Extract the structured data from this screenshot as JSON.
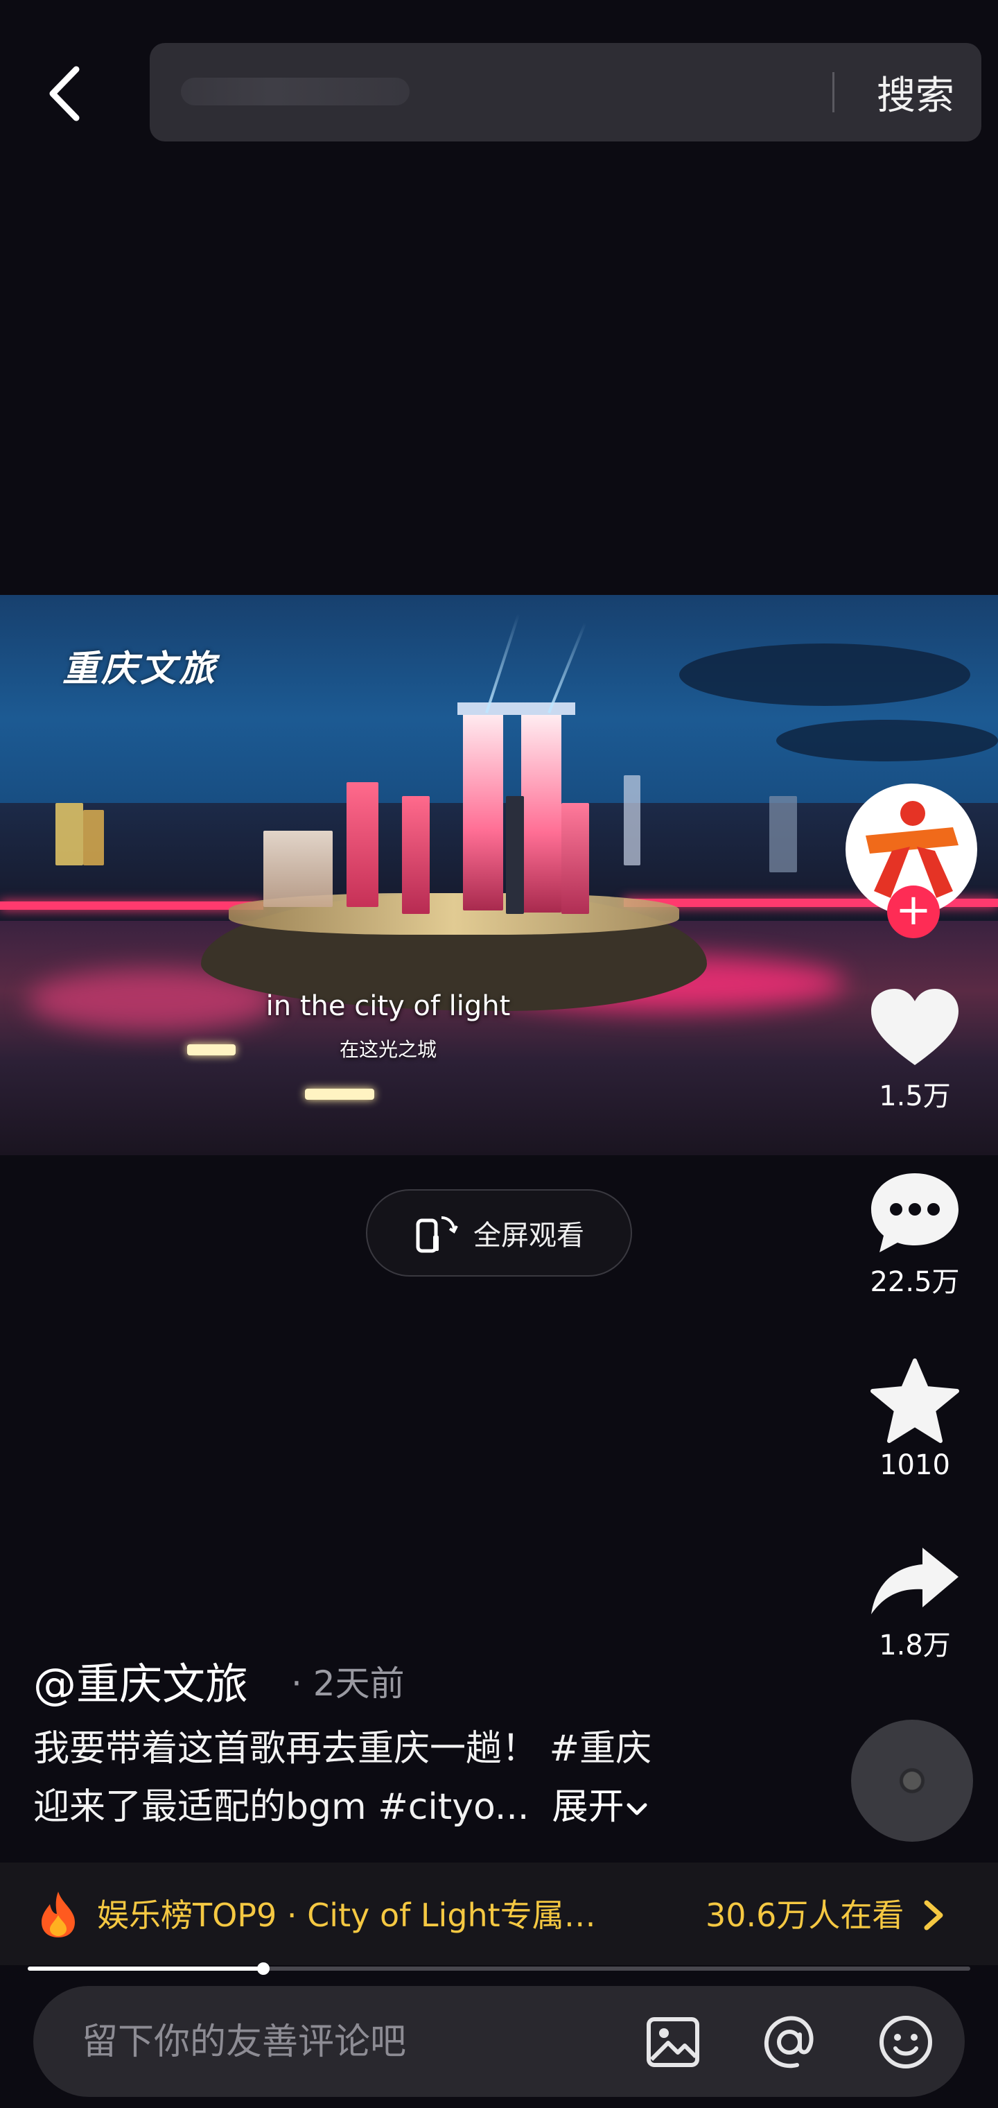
{
  "search": {
    "button_label": "搜索"
  },
  "video": {
    "watermark": "重庆文旅",
    "subtitle_en": "in the city of light",
    "subtitle_zh": "在这光之城"
  },
  "fullscreen": {
    "label": "全屏观看"
  },
  "rail": {
    "likes": "1.5万",
    "comments": "22.5万",
    "favorites": "1010",
    "shares": "1.8万"
  },
  "post": {
    "author": "@重庆文旅",
    "time": "· 2天前",
    "caption_line1": "我要带着这首歌再去重庆一趟！ #重庆",
    "caption_line2": "迎来了最适配的bgm #cityo...",
    "expand_label": "展开"
  },
  "trending": {
    "text": "娱乐榜TOP9 · City of Light专属…",
    "viewers": "30.6万人在看"
  },
  "playback": {
    "progress": 0.25
  },
  "comment": {
    "placeholder": "留下你的友善评论吧"
  },
  "colors": {
    "background": "#0c0b12",
    "accent_follow": "#fe2c55",
    "trending": "#f5c842"
  }
}
